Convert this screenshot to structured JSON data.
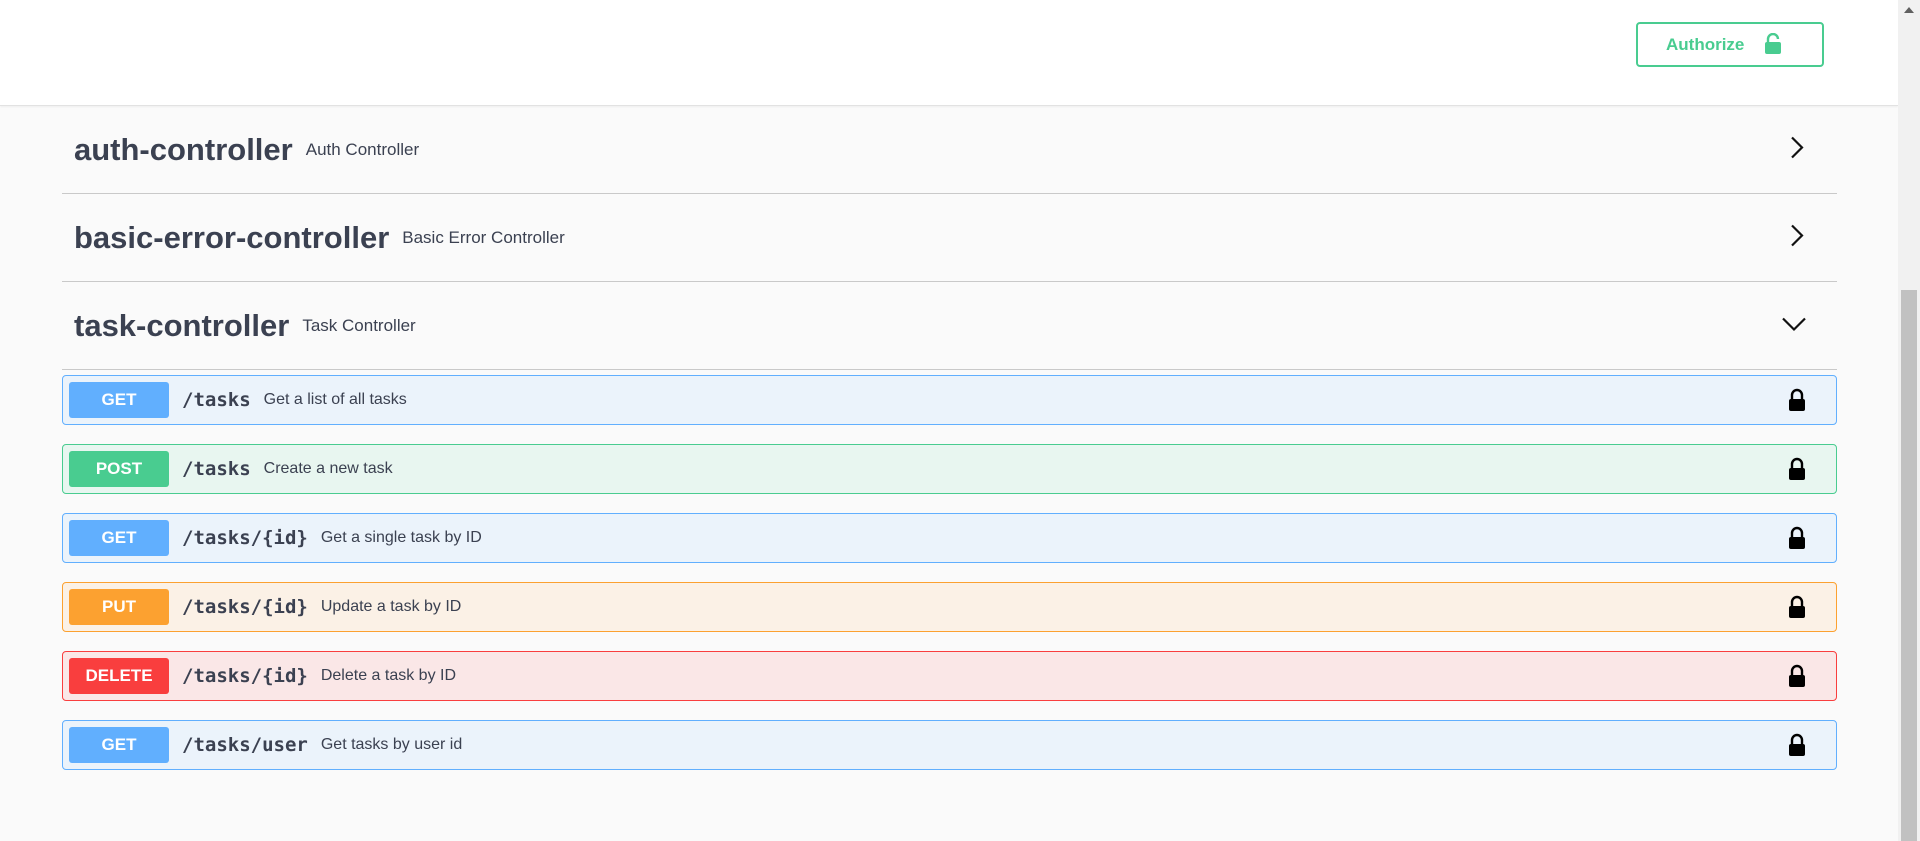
{
  "header": {
    "authorize_label": "Authorize"
  },
  "colors": {
    "get": "#61affe",
    "post": "#49cc90",
    "put": "#fca130",
    "delete": "#f93e3e"
  },
  "tags": [
    {
      "name": "auth-controller",
      "description": "Auth Controller",
      "expanded": false,
      "icon": "chevron-right-icon"
    },
    {
      "name": "basic-error-controller",
      "description": "Basic Error Controller",
      "expanded": false,
      "icon": "chevron-right-icon"
    },
    {
      "name": "task-controller",
      "description": "Task Controller",
      "expanded": true,
      "icon": "chevron-down-icon"
    }
  ],
  "operations": [
    {
      "method": "GET",
      "path": "/tasks",
      "summary": "Get a list of all tasks",
      "icon": "lock-icon"
    },
    {
      "method": "POST",
      "path": "/tasks",
      "summary": "Create a new task",
      "icon": "lock-icon"
    },
    {
      "method": "GET",
      "path": "/tasks/{id}",
      "summary": "Get a single task by ID",
      "icon": "lock-icon"
    },
    {
      "method": "PUT",
      "path": "/tasks/{id}",
      "summary": "Update a task by ID",
      "icon": "lock-icon"
    },
    {
      "method": "DELETE",
      "path": "/tasks/{id}",
      "summary": "Delete a task by ID",
      "icon": "lock-icon"
    },
    {
      "method": "GET",
      "path": "/tasks/user",
      "summary": "Get tasks by user id",
      "icon": "lock-icon"
    }
  ]
}
